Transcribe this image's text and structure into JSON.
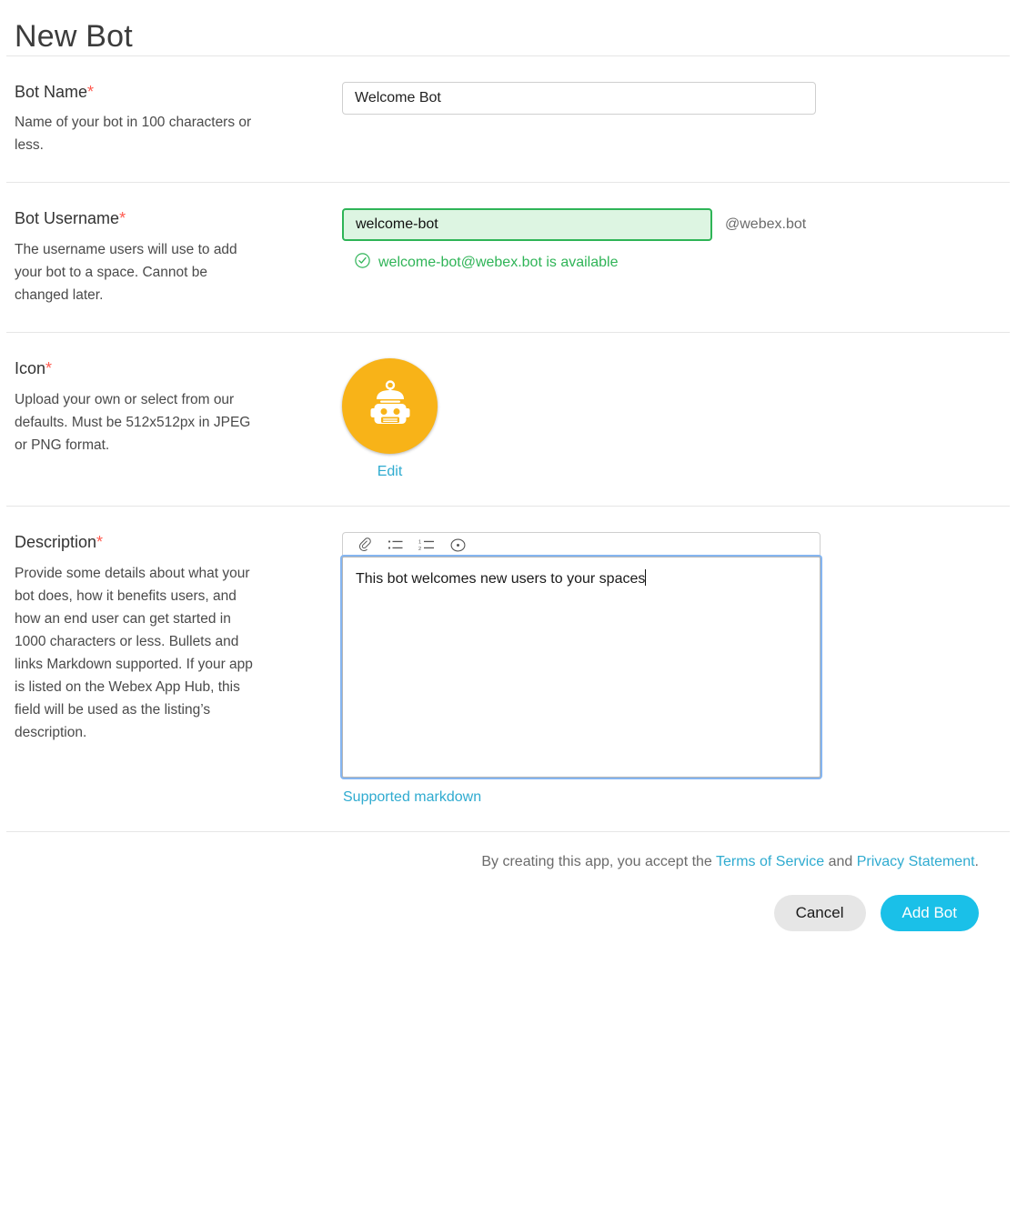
{
  "page": {
    "title": "New Bot"
  },
  "fields": {
    "bot_name": {
      "label": "Bot Name",
      "required_mark": "*",
      "help": "Name of your bot in 100 characters or less.",
      "value": "Welcome Bot",
      "placeholder": ""
    },
    "bot_username": {
      "label": "Bot Username",
      "required_mark": "*",
      "help": "The username users will use to add your bot to a space. Cannot be changed later.",
      "value": "welcome-bot",
      "placeholder": "",
      "domain_suffix": "@webex.bot",
      "availability_message": "welcome-bot@webex.bot is available",
      "availability_icon": "check-circle-icon",
      "availability_color": "#2fb457"
    },
    "icon": {
      "label": "Icon",
      "required_mark": "*",
      "help": "Upload your own or select from our defaults. Must be 512x512px in JPEG or PNG format.",
      "avatar_icon": "robot-icon",
      "avatar_color": "#f8b318",
      "edit_label": "Edit"
    },
    "description": {
      "label": "Description",
      "required_mark": "*",
      "help": "Provide some details about what your bot does, how it benefits users, and how an end user can get started in 1000 characters or less. Bullets and links Markdown supported. If your app is listed on the Webex App Hub, this field will be used as the listing’s description.",
      "value": "This bot welcomes new users to your spaces",
      "placeholder": "",
      "toolbar": [
        {
          "name": "attachment-icon",
          "title": "Link"
        },
        {
          "name": "bulleted-list-icon",
          "title": "Bulleted list"
        },
        {
          "name": "numbered-list-icon",
          "title": "Numbered list"
        },
        {
          "name": "emoji-icon",
          "title": "Emoji"
        }
      ],
      "markdown_link_label": "Supported markdown"
    }
  },
  "footer": {
    "legal_prefix": "By creating this app, you accept the ",
    "terms_label": "Terms of Service",
    "legal_middle": " and ",
    "privacy_label": "Privacy Statement",
    "legal_suffix": ".",
    "cancel_label": "Cancel",
    "submit_label": "Add Bot"
  },
  "colors": {
    "accent": "#1ac0e8",
    "link": "#2fabd0",
    "success": "#2fb457",
    "required": "#ff5a4f",
    "avatar": "#f8b318"
  }
}
